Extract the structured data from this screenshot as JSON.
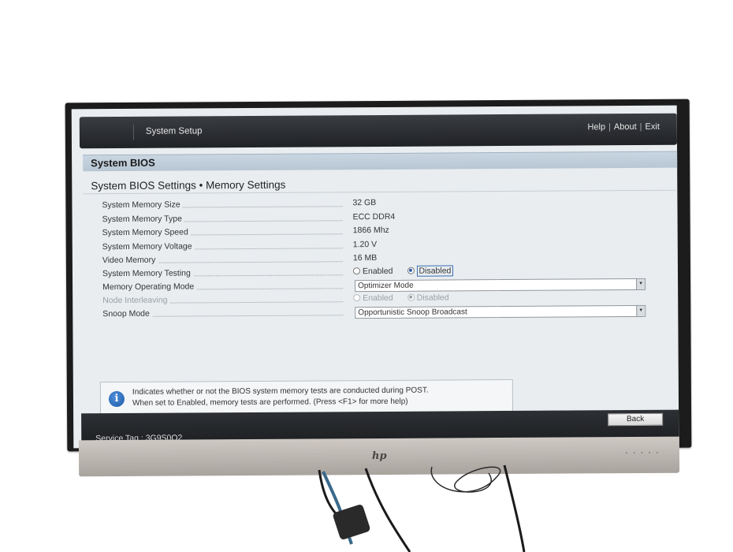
{
  "topbar": {
    "title": "System Setup",
    "help": "Help",
    "about": "About",
    "exit": "Exit",
    "separator": "|"
  },
  "section": {
    "header": "System BIOS",
    "subtitle": "System BIOS Settings • Memory Settings"
  },
  "settings": [
    {
      "label": "System Memory Size",
      "value": "32 GB"
    },
    {
      "label": "System Memory Type",
      "value": "ECC DDR4"
    },
    {
      "label": "System Memory Speed",
      "value": "1866 Mhz"
    },
    {
      "label": "System Memory Voltage",
      "value": "1.20 V"
    },
    {
      "label": "Video Memory",
      "value": "16 MB"
    },
    {
      "label": "System Memory Testing",
      "option_enabled": "Enabled",
      "option_disabled": "Disabled",
      "selected": "Disabled"
    },
    {
      "label": "Memory Operating Mode",
      "value": "Optimizer Mode"
    },
    {
      "label": "Node Interleaving",
      "option_enabled": "Enabled",
      "option_disabled": "Disabled",
      "selected": "Disabled"
    },
    {
      "label": "Snoop Mode",
      "value": "Opportunistic Snoop Broadcast"
    }
  ],
  "help": {
    "line1": "Indicates whether or not the BIOS system memory tests are conducted during POST.",
    "line2": "When set to Enabled, memory tests are performed. (Press <F1> for more help)",
    "icon": "i"
  },
  "footer": {
    "back": "Back",
    "service_tag": "Service Tag : 3G9S0Q2"
  },
  "monitor": {
    "brand": "hp"
  },
  "colors": {
    "accent": "#2d5da8",
    "topbar": "#2b2d31",
    "screen_bg": "#e9edf0"
  }
}
